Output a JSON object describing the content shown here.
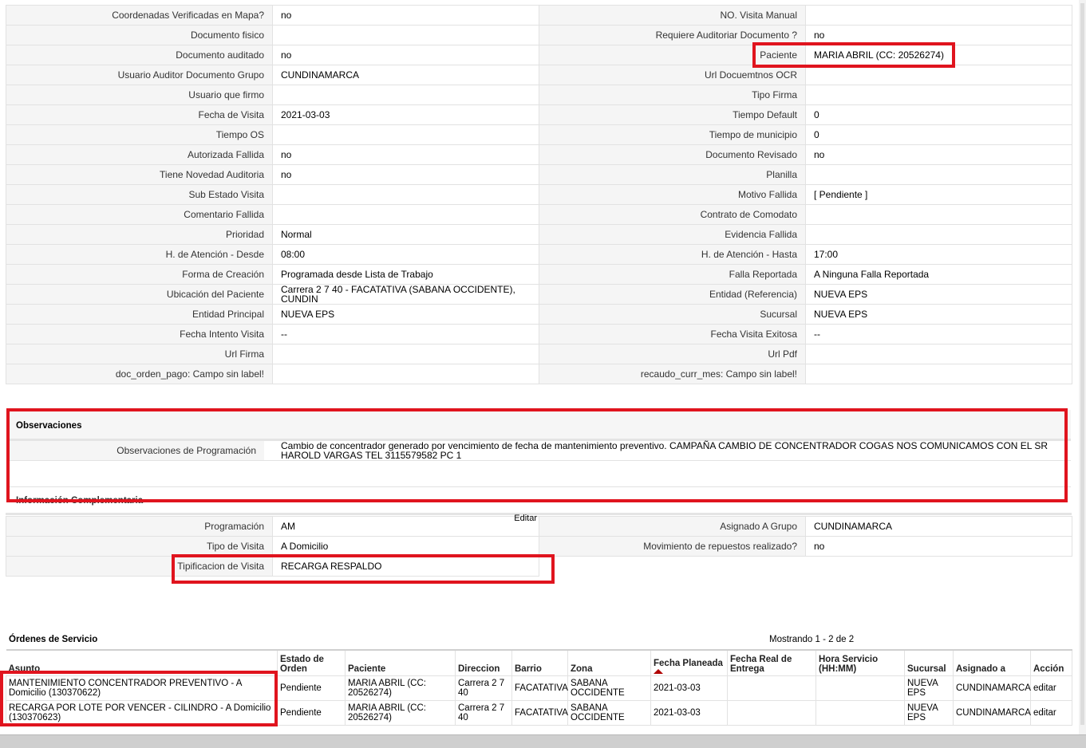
{
  "details": [
    {
      "l1": "Coordenadas Verificadas en Mapa?",
      "v1": "no",
      "l2": "NO. Visita Manual",
      "v2": ""
    },
    {
      "l1": "Documento fisico",
      "v1": "",
      "l2": "Requiere Auditoriar Documento ?",
      "v2": "no"
    },
    {
      "l1": "Documento auditado",
      "v1": "no",
      "l2": "Paciente",
      "v2": "MARIA ABRIL (CC: 20526274)"
    },
    {
      "l1": "Usuario Auditor Documento Grupo",
      "v1": "CUNDINAMARCA",
      "l2": "Url Docuemtnos OCR",
      "v2": ""
    },
    {
      "l1": "Usuario que firmo",
      "v1": "",
      "l2": "Tipo Firma",
      "v2": ""
    },
    {
      "l1": "Fecha de Visita",
      "v1": "2021-03-03",
      "l2": "Tiempo Default",
      "v2": "0"
    },
    {
      "l1": "Tiempo OS",
      "v1": "",
      "l2": "Tiempo de municipio",
      "v2": "0"
    },
    {
      "l1": "Autorizada Fallida",
      "v1": "no",
      "l2": "Documento Revisado",
      "v2": "no"
    },
    {
      "l1": "Tiene Novedad Auditoria",
      "v1": "no",
      "l2": "Planilla",
      "v2": ""
    },
    {
      "l1": "Sub Estado Visita",
      "v1": "",
      "l2": "Motivo Fallida",
      "v2": "[ Pendiente ]"
    },
    {
      "l1": "Comentario Fallida",
      "v1": "",
      "l2": "Contrato de Comodato",
      "v2": ""
    },
    {
      "l1": "Prioridad",
      "v1": "Normal",
      "l2": "Evidencia Fallida",
      "v2": ""
    },
    {
      "l1": "H. de Atención - Desde",
      "v1": "08:00",
      "l2": "H. de Atención - Hasta",
      "v2": "17:00"
    },
    {
      "l1": "Forma de Creación",
      "v1": "Programada desde Lista de Trabajo",
      "l2": "Falla Reportada",
      "v2": "A Ninguna Falla Reportada"
    },
    {
      "l1": "Ubicación del Paciente",
      "v1": "Carrera 2 7 40 - FACATATIVA (SABANA OCCIDENTE), CUNDIN",
      "l2": "Entidad (Referencia)",
      "v2": "NUEVA EPS"
    },
    {
      "l1": "Entidad Principal",
      "v1": "NUEVA EPS",
      "l2": "Sucursal",
      "v2": "NUEVA EPS"
    },
    {
      "l1": "Fecha Intento Visita",
      "v1": "--",
      "l2": "Fecha Visita Exitosa",
      "v2": "--"
    },
    {
      "l1": "Url Firma",
      "v1": "",
      "l2": "Url Pdf",
      "v2": ""
    },
    {
      "l1": "doc_orden_pago: Campo sin label!",
      "v1": "",
      "l2": "recaudo_curr_mes: Campo sin label!",
      "v2": ""
    }
  ],
  "observaciones": {
    "title": "Observaciones",
    "label": "Observaciones de Programación",
    "value": "Cambio de concentrador generado por vencimiento de fecha de mantenimiento preventivo. CAMPAÑA CAMBIO DE CONCENTRADOR COGAS NOS COMUNICAMOS CON EL SR HAROLD VARGAS TEL 3115579582 PC 1"
  },
  "info": {
    "title": "Información Complementaria",
    "edit_label": "Editar",
    "rows": [
      {
        "l1": "Programación",
        "v1": "AM",
        "l2": "Asignado A Grupo",
        "v2": "CUNDINAMARCA"
      },
      {
        "l1": "Tipo de Visita",
        "v1": "A Domicilio",
        "l2": "Movimiento de repuestos realizado?",
        "v2": "no"
      },
      {
        "l1": "Tipificacion de Visita",
        "v1": "RECARGA RESPALDO"
      }
    ]
  },
  "orders": {
    "title": "Órdenes de Servicio",
    "showing": "Mostrando 1 - 2 de 2",
    "columns": [
      "Asunto",
      "Estado de Orden",
      "Paciente",
      "Direccion",
      "Barrio",
      "Zona",
      "Fecha Planeada",
      "Fecha Real de Entrega",
      "Hora Servicio (HH:MM)",
      "Sucursal",
      "Asignado a",
      "Acción"
    ],
    "rows": [
      [
        "MANTENIMIENTO CONCENTRADOR PREVENTIVO - A Domicilio (130370622)",
        "Pendiente",
        "MARIA ABRIL (CC: 20526274)",
        "Carrera 2 7 40",
        "FACATATIVA",
        "SABANA OCCIDENTE",
        "2021-03-03",
        "",
        "",
        "NUEVA EPS",
        "CUNDINAMARCA",
        "editar"
      ],
      [
        "RECARGA POR LOTE POR VENCER - CILINDRO - A Domicilio (130370623)",
        "Pendiente",
        "MARIA ABRIL (CC: 20526274)",
        "Carrera 2 7 40",
        "FACATATIVA",
        "SABANA OCCIDENTE",
        "2021-03-03",
        "",
        "",
        "NUEVA EPS",
        "CUNDINAMARCA",
        "editar"
      ]
    ]
  },
  "highlight_color": "#e0141e"
}
